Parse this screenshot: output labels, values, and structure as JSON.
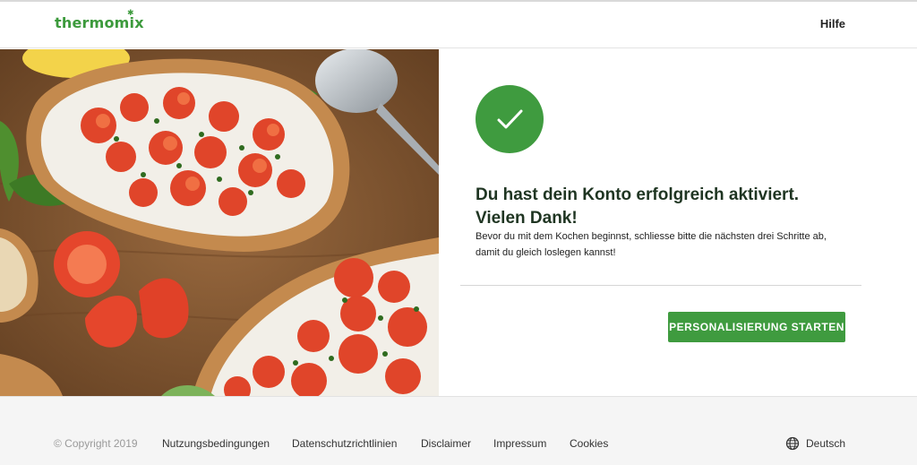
{
  "header": {
    "logo_text": "thermomix",
    "help_label": "Hilfe"
  },
  "confirmation": {
    "title_line1": "Du hast dein Konto erfolgreich aktiviert.",
    "title_line2": "Vielen Dank!",
    "description": "Bevor du mit dem Kochen beginnst, schliesse bitte die nächsten drei Schritte ab, damit du gleich loslegen kannst!",
    "cta_label": "PERSONALISIERUNG STARTEN",
    "icon": "checkmark-icon"
  },
  "hero": {
    "icon": "bruschetta-photo"
  },
  "footer": {
    "copyright": "© Copyright 2019",
    "links": [
      "Nutzungsbedingungen",
      "Datenschutzrichtlinien",
      "Disclaimer",
      "Impressum",
      "Cookies"
    ],
    "language": "Deutsch",
    "language_icon": "globe-icon"
  },
  "colors": {
    "brand_green": "#3f9b3f",
    "title_text": "#1f3522",
    "footer_bg": "#f5f5f5"
  }
}
